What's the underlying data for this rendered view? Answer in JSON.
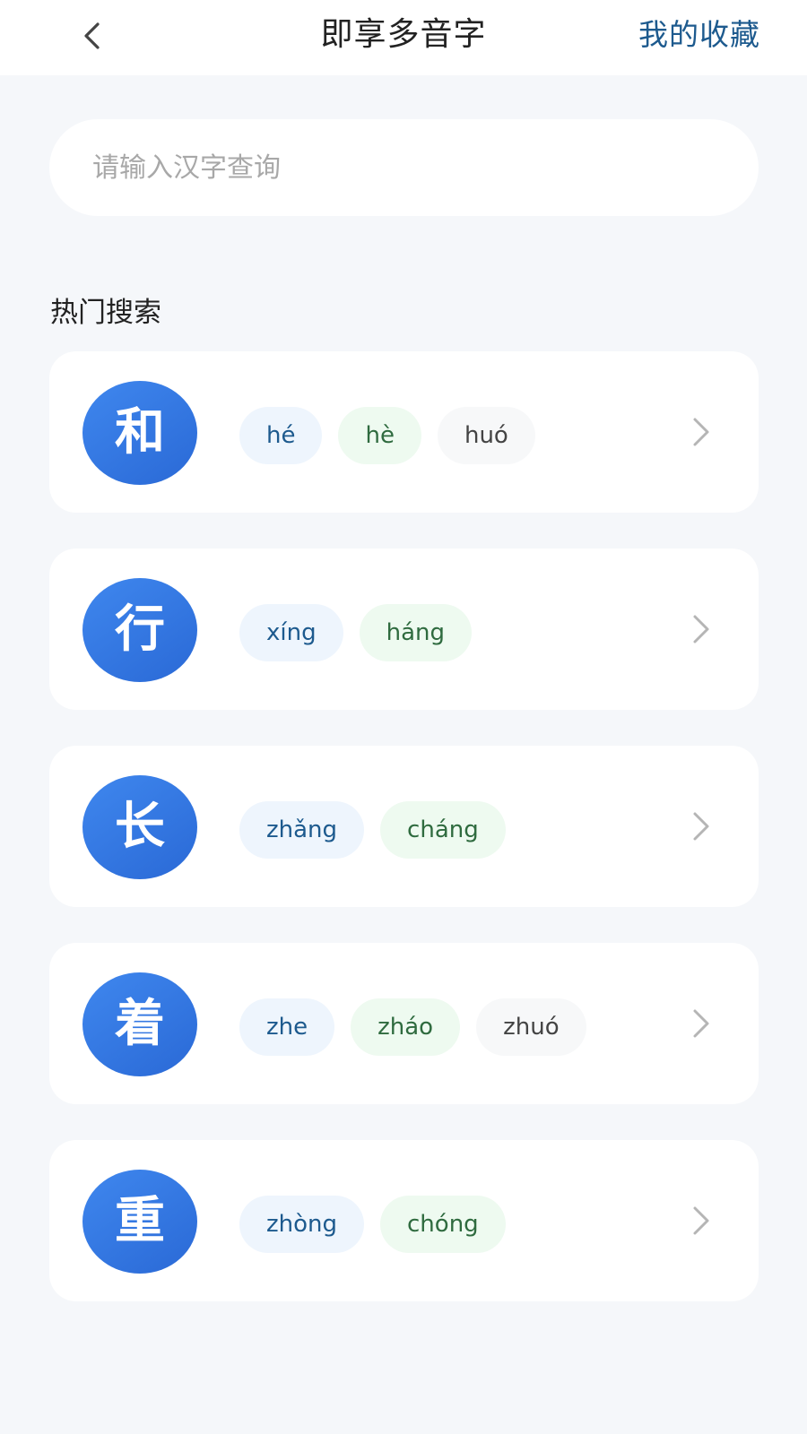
{
  "header": {
    "title": "即享多音字",
    "favorites_label": "我的收藏"
  },
  "search": {
    "placeholder": "请输入汉字查询"
  },
  "hot": {
    "title": "热门搜索",
    "items": [
      {
        "char": "和",
        "readings": [
          "hé",
          "hè",
          "huó"
        ]
      },
      {
        "char": "行",
        "readings": [
          "xíng",
          "háng"
        ]
      },
      {
        "char": "长",
        "readings": [
          "zhǎng",
          "cháng"
        ]
      },
      {
        "char": "着",
        "readings": [
          "zhe",
          "zháo",
          "zhuó"
        ]
      },
      {
        "char": "重",
        "readings": [
          "zhòng",
          "chóng"
        ]
      }
    ]
  },
  "icons": {
    "back": "chevron-left-icon",
    "row_arrow": "chevron-right-icon"
  },
  "colors": {
    "accent_blue": "#2f74e0",
    "link_blue": "#1d5a8e",
    "reading_blue_bg": "#eef5fd",
    "reading_green_bg": "#eefaf0",
    "reading_gray_bg": "#f7f8f9",
    "page_bg": "#f5f7fa"
  }
}
